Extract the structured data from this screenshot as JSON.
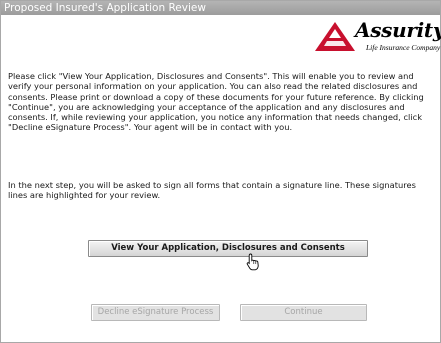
{
  "window": {
    "title": "Proposed Insured's Application Review"
  },
  "logo": {
    "name": "Assurity",
    "subtitle": "Life Insurance Company",
    "icon": "triangle-logo-icon",
    "color": "#c8102e"
  },
  "content": {
    "paragraph1": "Please click \"View Your Application, Disclosures and Consents\". This will enable you to review and verify your personal information on your application. You can also read the related disclosures and consents. Please print or download a copy of these documents for your future reference. By clicking \"Continue\", you are acknowledging your acceptance of the application and any disclosures and consents. If, while reviewing your application, you notice any information that needs changed, click \"Decline eSignature Process\". Your agent will be in contact with you.",
    "paragraph2": "In the next step, you will be asked to sign all forms that contain a signature line. These signatures lines are highlighted for your review."
  },
  "buttons": {
    "view_label": "View Your Application, Disclosures and Consents",
    "decline_label": "Decline eSignature Process",
    "continue_label": "Continue"
  },
  "cursor": {
    "icon": "hand-pointer-icon"
  }
}
